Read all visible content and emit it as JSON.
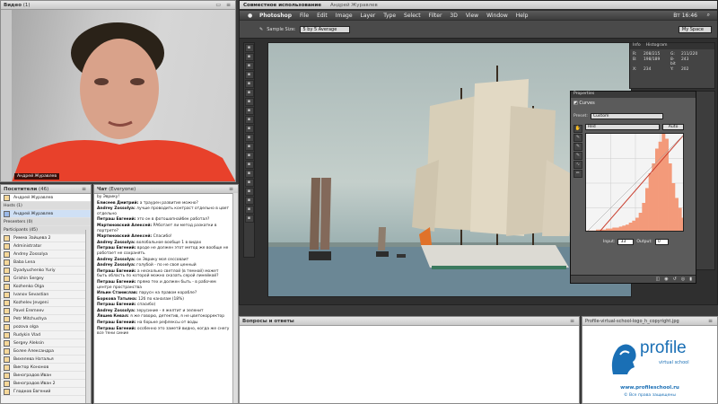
{
  "video": {
    "title": "Видео",
    "count": "(1)",
    "name_tag": "Андрей Журавлев"
  },
  "app_header": {
    "title": "Совместное использование",
    "presenter": "Андрей Журавлев"
  },
  "participants": {
    "title": "Посетители",
    "count": "(46)",
    "me": "Андрей Журавлев",
    "hosts_label": "Hosts (1)",
    "host_name": "Андрей Журавлев",
    "presenters_label": "Presenters (0)",
    "participants_label": "Participants (45)",
    "list": [
      "Римма Зайцева 2",
      "Administrator",
      "Andrey Zossolya",
      "Baba Lena",
      "Dyadyuchenko Yuriy",
      "Grishin Sergey",
      "Kozhenko Olga",
      "Ivanov Sevastian",
      "Kozhelev Jevgeni",
      "Pavel Eremeev",
      "Petr Mitchushya",
      "pozova olga",
      "Rudykin Vlad",
      "Sergey Aleksin",
      "Более Александра",
      "Вихелева Наталья",
      "Виктор Кононов",
      "Виноградов Иван",
      "Виноградов Иван 2",
      "Гладков Евгений"
    ]
  },
  "chat": {
    "title": "Чат",
    "scope": "(Everyone)",
    "messages": [
      {
        "name": "",
        "text": "by Эврику!"
      },
      {
        "name": "Елисеев Дмитрий:",
        "text": "а траурен развитие можно?"
      },
      {
        "name": "Andrey Zossolya:",
        "text": "лучше проводить контраст отдельно в цвет отдельно"
      },
      {
        "name": "Петраш Евгений:",
        "text": "это он в фотошопнайбек работал?"
      },
      {
        "name": "Мартиновский Алексей:",
        "text": "РАботает ли метод разкатки в портрете?"
      },
      {
        "name": "Мартиновский Алексей:",
        "text": "Спасибо!"
      },
      {
        "name": "Andrey Zossolya:",
        "text": "волобальное вообще 1 в видах"
      },
      {
        "name": "Петраш Евгений:",
        "text": "вроде не должен этот метод же вообще не работает не сохранять"
      },
      {
        "name": "Andrey Zossolya:",
        "text": "ок Эврику моя сессоваит"
      },
      {
        "name": "Andrey Zossolya:",
        "text": "голубой - по не своя ценный"
      },
      {
        "name": "Петраш Евгений:",
        "text": "а несколько светлой (в темной) может быть область по которой можно сказать серой линейкой?"
      },
      {
        "name": "Петраш Евгений:",
        "text": "прямо тех и должен быть - в рабочем центре пространства"
      },
      {
        "name": "Ильин Станислав:",
        "text": "парусн на правом корабле?"
      },
      {
        "name": "Боркова Татьяна:",
        "text": "12б по каналам (18%)"
      },
      {
        "name": "Петраш Евгений:",
        "text": "спасибо)"
      },
      {
        "name": "Andrey Zossolya:",
        "text": "зерусиние - я желтит и зеленит"
      },
      {
        "name": "Ляшев Кевал:",
        "text": "я же говорю, детектив, я не цветокорректор"
      },
      {
        "name": "Петраш Евгений:",
        "text": "на борьке рефлексы от воды"
      },
      {
        "name": "Петраш Евгений:",
        "text": "особенно это заметй видно, когда же снегу все тени синие"
      }
    ]
  },
  "questions": {
    "title": "Вопросы и ответы"
  },
  "logo_pod": {
    "title": "Profile-virtual-school-logo_h_copyright.jpg",
    "brand": "profile",
    "sub": "virtual school",
    "url": "www.profileschool.ru",
    "copy": "© Все права защищены"
  },
  "photoshop": {
    "app_name": "Photoshop",
    "menu": [
      "File",
      "Edit",
      "Image",
      "Layer",
      "Type",
      "Select",
      "Filter",
      "3D",
      "View",
      "Window",
      "Help"
    ],
    "clock": "Вт 16:46",
    "options_label": "Sample Size:",
    "options_value": "5 by 5 Average",
    "workspace": "My Space",
    "info_title": "Info",
    "histogram_title": "Histogram",
    "properties": {
      "title": "Properties",
      "adjustment": "Curves",
      "preset_label": "Preset:",
      "preset_value": "Custom",
      "channel_value": "Red",
      "auto_label": "Auto",
      "input_label": "Input:",
      "input_value": "33",
      "output_label": "Output:",
      "output_value": "0"
    },
    "info_values": [
      "R:",
      "G:",
      "B:",
      "8-bit",
      "X:",
      "Y:"
    ],
    "info_nums": [
      "208/215",
      "211/220",
      "198/189",
      "243",
      "234",
      "202"
    ]
  },
  "colors": {
    "accent_orange": "#f39a7a",
    "logo_blue": "#1a6fb5",
    "ps_dark": "#3b3b3b"
  },
  "chart_data": {
    "type": "area",
    "title": "Curves histogram (Red)",
    "channel": "Red",
    "xlim": [
      0,
      255
    ],
    "ylim": [
      0,
      100
    ],
    "curve_points": [
      [
        33,
        0
      ],
      [
        255,
        255
      ]
    ],
    "histogram": [
      2,
      2,
      2,
      3,
      3,
      3,
      4,
      4,
      5,
      5,
      6,
      7,
      8,
      10,
      12,
      15,
      20,
      30,
      45,
      60,
      70,
      85,
      92,
      100,
      95,
      70,
      50,
      35,
      25,
      15
    ]
  }
}
